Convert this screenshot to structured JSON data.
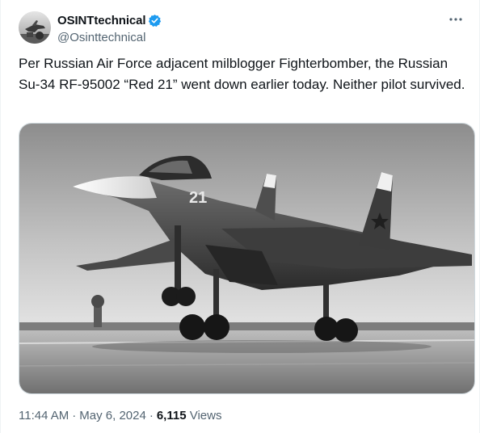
{
  "author": {
    "display_name": "OSINTtechnical",
    "handle": "@Osinttechnical",
    "verified": true,
    "verified_color": "#1d9bf0",
    "avatar_icon": "avatar-photo"
  },
  "tweet": {
    "text": "Per Russian Air Force adjacent milblogger Fighterbomber, the Russian Su-34 RF-95002 “Red 21” went down earlier today. Neither pilot survived.",
    "media": {
      "type": "photo",
      "style": "black-and-white",
      "aircraft_marking": "21"
    }
  },
  "meta": {
    "time": "11:44 AM",
    "separator": "·",
    "date": "May 6, 2024",
    "views_count": "6,115",
    "views_label": "Views"
  },
  "icons": {
    "more": "more-dots-icon",
    "verified": "verified-badge-icon"
  },
  "colors": {
    "text_primary": "#0f1419",
    "text_secondary": "#536471",
    "border": "#cfd9de"
  }
}
